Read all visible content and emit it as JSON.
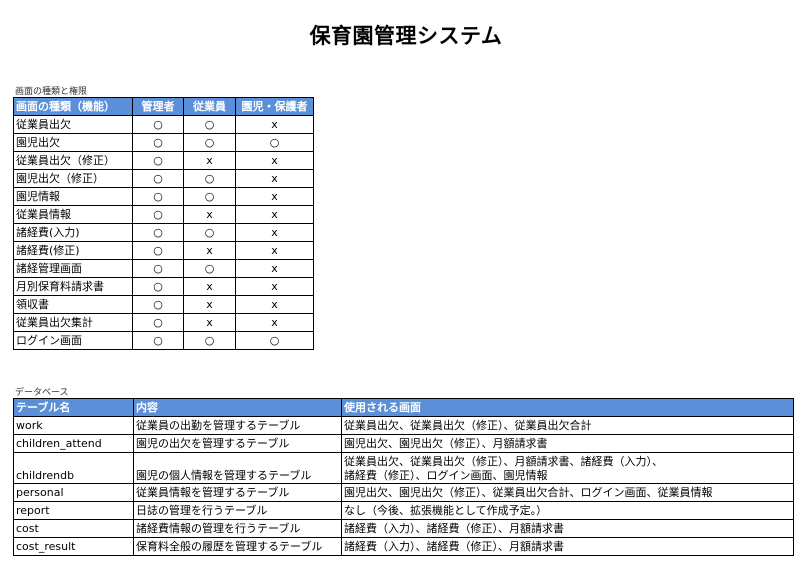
{
  "title": "保育園管理システム",
  "permissions": {
    "caption": "画面の種類と権限",
    "headers": [
      "画面の種類（機能）",
      "管理者",
      "従業員",
      "園児・保護者"
    ],
    "rows": [
      [
        "従業員出欠",
        "○",
        "○",
        "x"
      ],
      [
        "園児出欠",
        "○",
        "○",
        "○"
      ],
      [
        "従業員出欠（修正）",
        "○",
        "x",
        "x"
      ],
      [
        "園児出欠（修正）",
        "○",
        "○",
        "x"
      ],
      [
        "園児情報",
        "○",
        "○",
        "x"
      ],
      [
        "従業員情報",
        "○",
        "x",
        "x"
      ],
      [
        "諸経費(入力)",
        "○",
        "○",
        "x"
      ],
      [
        "諸経費(修正)",
        "○",
        "x",
        "x"
      ],
      [
        "諸経管理画面",
        "○",
        "○",
        "x"
      ],
      [
        "月別保育料請求書",
        "○",
        "x",
        "x"
      ],
      [
        "領収書",
        "○",
        "x",
        "x"
      ],
      [
        "従業員出欠集計",
        "○",
        "x",
        "x"
      ],
      [
        "ログイン画面",
        "○",
        "○",
        "○"
      ]
    ]
  },
  "database": {
    "caption": "データベース",
    "headers": [
      "テーブル名",
      "内容",
      "使用される画面"
    ],
    "rows": [
      [
        "work",
        "従業員の出勤を管理するテーブル",
        "従業員出欠、従業員出欠（修正）、従業員出欠合計"
      ],
      [
        "children_attend",
        "園児の出欠を管理するテーブル",
        "園児出欠、園児出欠（修正）、月額請求書"
      ],
      [
        "childrendb",
        "園児の個人情報を管理するテーブル",
        "従業員出欠、従業員出欠（修正）、月額請求書、諸経費（入力）、\n諸経費（修正）、ログイン画面、園児情報"
      ],
      [
        "personal",
        "従業員情報を管理するテーブル",
        "園児出欠、園児出欠（修正）、従業員出欠合計、ログイン画面、従業員情報"
      ],
      [
        "report",
        "日誌の管理を行うテーブル",
        "なし（今後、拡張機能として作成予定。）"
      ],
      [
        "cost",
        "諸経費情報の管理を行うテーブル",
        "諸経費（入力）、諸経費（修正）、月額請求書"
      ],
      [
        "cost_result",
        "保育料全般の履歴を管理するテーブル",
        "諸経費（入力）、諸経費（修正）、月額請求書"
      ]
    ]
  }
}
